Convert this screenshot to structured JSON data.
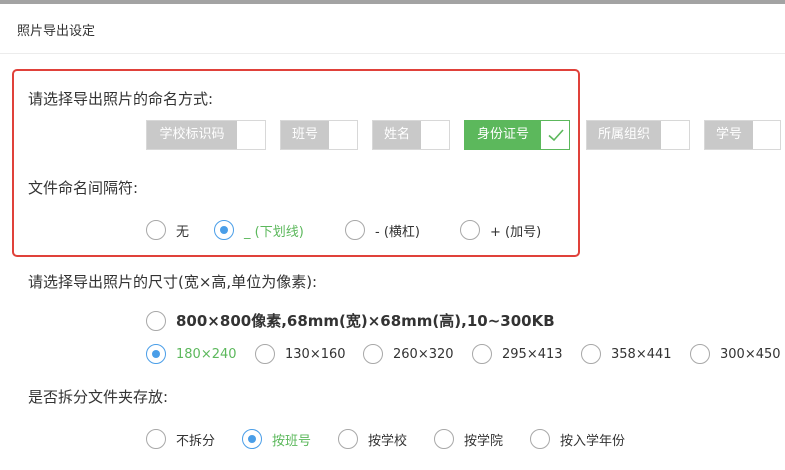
{
  "dialog": {
    "title": "照片导出设定"
  },
  "naming": {
    "label": "请选择导出照片的命名方式:",
    "options": [
      {
        "label": "学校标识码",
        "selected": false
      },
      {
        "label": "班号",
        "selected": false
      },
      {
        "label": "姓名",
        "selected": false
      },
      {
        "label": "身份证号",
        "selected": true
      },
      {
        "label": "所属组织",
        "selected": false
      },
      {
        "label": "学号",
        "selected": false
      }
    ]
  },
  "separator": {
    "label": "文件命名间隔符:",
    "options": [
      {
        "label": "无",
        "checked": false
      },
      {
        "label": "_ (下划线)",
        "checked": true
      },
      {
        "label": "- (横杠)",
        "checked": false
      },
      {
        "label": "+ (加号)",
        "checked": false
      }
    ]
  },
  "size": {
    "label": "请选择导出照片的尺寸(宽×高,单位为像素):",
    "options": [
      {
        "label": "800×800像素,68mm(宽)×68mm(高),10~300KB",
        "checked": false
      },
      {
        "label": "180×240",
        "checked": true
      },
      {
        "label": "130×160",
        "checked": false
      },
      {
        "label": "260×320",
        "checked": false
      },
      {
        "label": "295×413",
        "checked": false
      },
      {
        "label": "358×441",
        "checked": false
      },
      {
        "label": "300×450",
        "checked": false
      }
    ]
  },
  "split": {
    "label": "是否拆分文件夹存放:",
    "options": [
      {
        "label": "不拆分",
        "checked": false
      },
      {
        "label": "按班号",
        "checked": true
      },
      {
        "label": "按学校",
        "checked": false
      },
      {
        "label": "按学院",
        "checked": false
      },
      {
        "label": "按入学年份",
        "checked": false
      }
    ]
  },
  "colors": {
    "accent_green": "#5cb85c",
    "radio_blue": "#4a9ee8",
    "highlight_red": "#e0413a",
    "chip_gray": "#c9c9c9"
  },
  "icons": {
    "selected_chip": "check-icon"
  }
}
